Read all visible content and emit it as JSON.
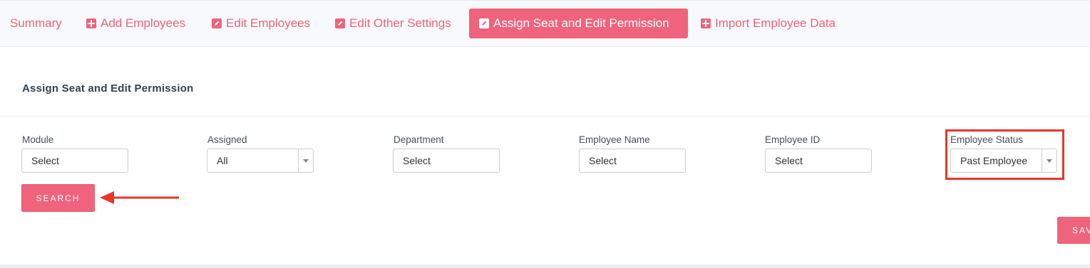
{
  "tabs": [
    {
      "label": "Summary",
      "icon": "",
      "active": false
    },
    {
      "label": "Add Employees",
      "icon": "plus-square-icon",
      "active": false
    },
    {
      "label": "Edit Employees",
      "icon": "edit-icon",
      "active": false
    },
    {
      "label": "Edit Other Settings",
      "icon": "edit-icon",
      "active": false
    },
    {
      "label": "Assign Seat and Edit Permission",
      "icon": "edit-icon",
      "active": true
    },
    {
      "label": "Import Employee Data",
      "icon": "plus-square-icon",
      "active": false
    }
  ],
  "section": {
    "title": "Assign Seat and Edit Permission"
  },
  "filters": {
    "module": {
      "label": "Module",
      "value": "Select"
    },
    "assigned": {
      "label": "Assigned",
      "value": "All"
    },
    "department": {
      "label": "Department",
      "value": "Select"
    },
    "employee_name": {
      "label": "Employee Name",
      "value": "Select"
    },
    "employee_id": {
      "label": "Employee ID",
      "value": "Select"
    },
    "employee_status": {
      "label": "Employee Status",
      "value": "Past Employee"
    }
  },
  "buttons": {
    "search": "SEARCH",
    "save": "SAV"
  },
  "colors": {
    "accent": "#f0637c",
    "annotation": "#e8352a",
    "tabbar_bg": "#f8f9fc"
  }
}
